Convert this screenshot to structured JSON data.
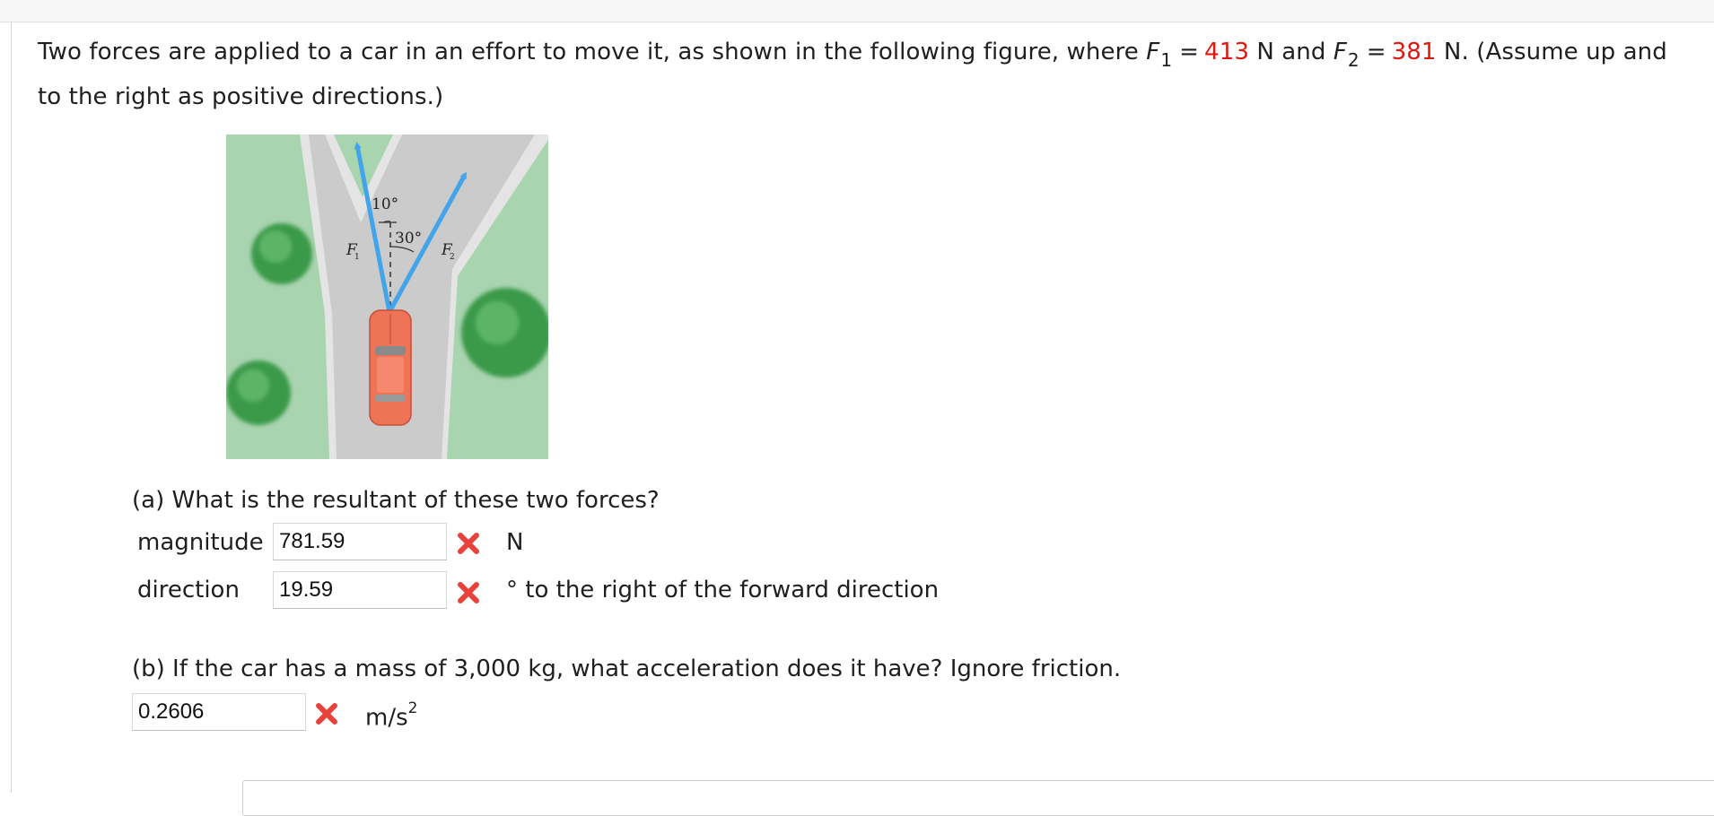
{
  "problem": {
    "text_a": "Two forces are applied to a car in an effort to move it, as shown in the following figure, where ",
    "f1_symbol": "F",
    "f1_sub": "1",
    "equals": "=",
    "f1_value": "413",
    "f1_unit": " N and ",
    "f2_symbol": "F",
    "f2_sub": "2",
    "f2_value": "381",
    "text_b": " N. (Assume up and to the right as positive directions.)"
  },
  "figure": {
    "angle_1": "10°",
    "angle_2": "30°",
    "label_f1": "F",
    "label_f1_sub": "1",
    "label_f2": "F",
    "label_f2_sub": "2",
    "colors": {
      "grass": "#a9d4b0",
      "road": "#cfcfcf",
      "road_edge": "#e6e6e6",
      "arrow": "#42a4ea",
      "car": "#ef7357",
      "tree": "#3a9a48"
    }
  },
  "part_a": {
    "question": "(a) What is the resultant of these two forces?",
    "magnitude_label": "magnitude",
    "magnitude_value": "781.59",
    "magnitude_status": "incorrect",
    "magnitude_unit": "N",
    "direction_label": "direction",
    "direction_value": "19.59",
    "direction_status": "incorrect",
    "direction_unit": "° to the right of the forward direction"
  },
  "part_b": {
    "question": "(b) If the car has a mass of 3,000 kg, what acceleration does it have? Ignore friction.",
    "value": "0.2606",
    "status": "incorrect",
    "unit": "m/s",
    "unit_exp": "2"
  },
  "status_icon": "x-mark-icon",
  "status_color": "#e8423b"
}
